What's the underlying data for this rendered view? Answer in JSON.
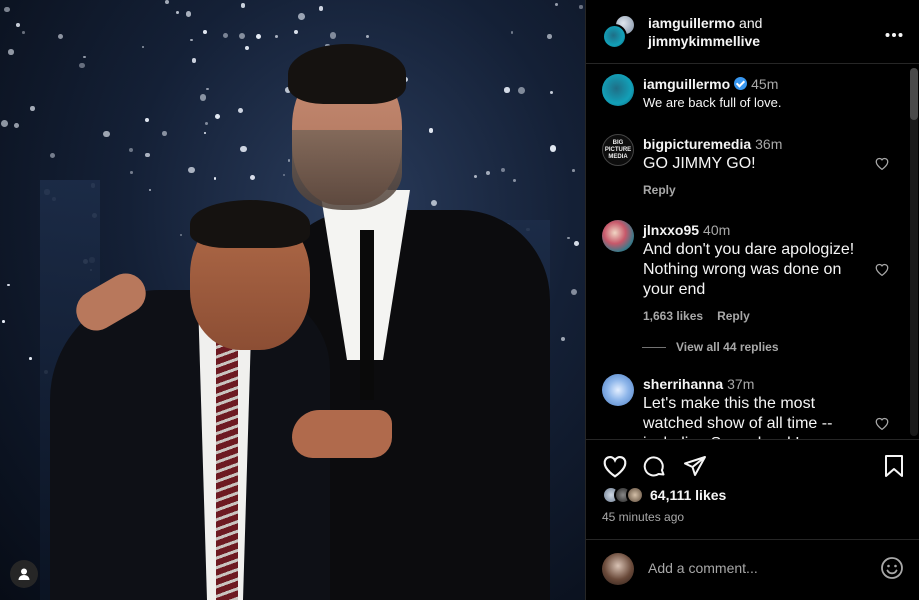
{
  "header": {
    "owner1": "iamguillermo",
    "conjunction": "and",
    "owner2": "jimmykimmellive",
    "more_icon": "more-horizontal-icon"
  },
  "caption": {
    "username": "iamguillermo",
    "verified": true,
    "time": "45m",
    "text": "We are back full of love."
  },
  "comments": [
    {
      "username": "bigpicturemedia",
      "time": "36m",
      "text": "GO JIMMY GO!",
      "likes": "",
      "reply": "Reply"
    },
    {
      "username": "jlnxxo95",
      "time": "40m",
      "text": "And don't you dare apologize! Nothing wrong was done on your end",
      "likes": "1,663 likes",
      "reply": "Reply"
    },
    {
      "username": "sherrihanna",
      "time": "37m",
      "text": "Let's make this the most watched show of all time -- including Super bowl !",
      "likes": "",
      "reply": ""
    }
  ],
  "view_replies": "View all 44 replies",
  "actions": {
    "likes": "64,111 likes",
    "posted": "45 minutes ago"
  },
  "compose": {
    "placeholder": "Add a comment..."
  },
  "colors": {
    "background": "#000000",
    "secondary_text": "#a8a8a8",
    "verified": "#3897f0",
    "divider": "#262626"
  }
}
